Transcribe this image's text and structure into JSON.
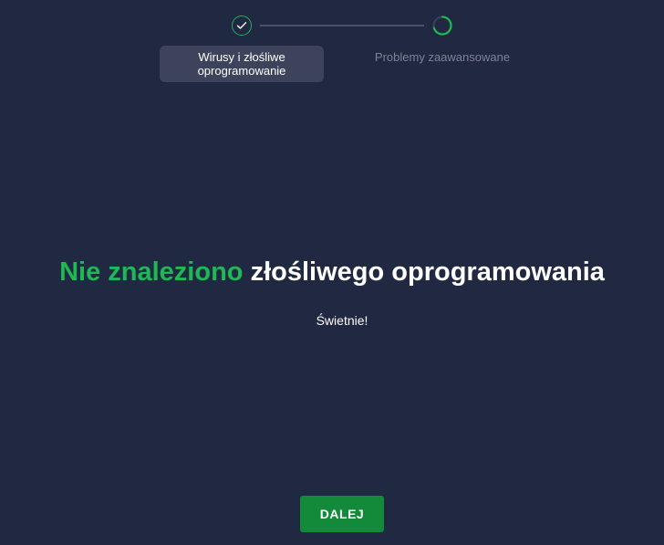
{
  "stepper": {
    "steps": [
      {
        "label": "Wirusy i złośliwe oprogramowanie",
        "state": "completed",
        "icon": "check-icon"
      },
      {
        "label": "Problemy zaawansowane",
        "state": "in-progress",
        "icon": "progress-ring-icon",
        "progress": 0.7
      }
    ]
  },
  "result": {
    "headline_highlight": "Nie znaleziono",
    "headline_rest": "złośliwego oprogramowania",
    "subtext": "Świetnie!"
  },
  "actions": {
    "next_label": "DALEJ"
  },
  "colors": {
    "background": "#212841",
    "accent_green": "#1db954",
    "button_green": "#138a3a",
    "muted_text": "#7d8294"
  }
}
